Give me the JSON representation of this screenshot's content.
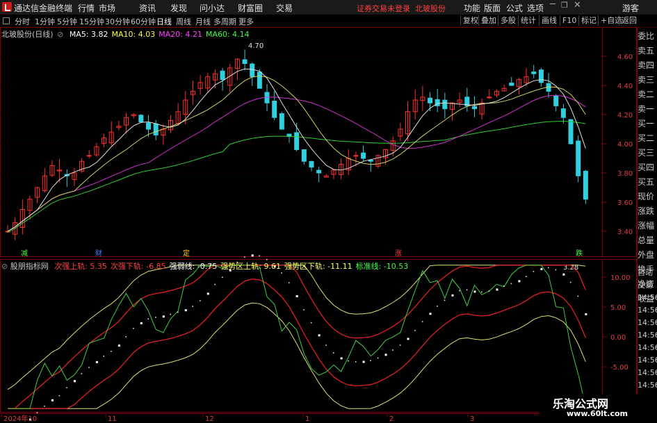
{
  "app": {
    "title": "通达信金融终端",
    "menu": [
      "行情",
      "市场",
      "资讯",
      "发现",
      "问小达",
      "财富圈",
      "交易"
    ],
    "warning": "证券交易未登录",
    "stock_name": "北玻股份",
    "right_menu": [
      "功能",
      "版面",
      "公式",
      "选项"
    ],
    "user": "游客"
  },
  "toolbar": {
    "periods": [
      "分时",
      "1分钟",
      "5分钟",
      "15分钟",
      "30分钟",
      "60分钟",
      "日线",
      "周线",
      "月线",
      "多周期",
      "更多"
    ],
    "active_period": "日线",
    "right": [
      "复权",
      "叠加",
      "多股",
      "统计",
      "画线",
      "F10",
      "标记",
      "+自选",
      "返回"
    ]
  },
  "main_chart": {
    "title": "北玻股份(日线)",
    "ma_labels": [
      {
        "text": "MA5: 3.82",
        "color": "#ffffff"
      },
      {
        "text": "MA10: 4.03",
        "color": "#ffff40"
      },
      {
        "text": "MA20: 4.21",
        "color": "#ff40ff"
      },
      {
        "text": "MA60: 4.14",
        "color": "#40ff40"
      }
    ],
    "y_ticks": [
      "4.60",
      "4.40",
      "4.20",
      "4.00",
      "3.80",
      "3.60",
      "3.40"
    ],
    "high_label": "4.70",
    "low_label": "3.28",
    "markers": [
      {
        "text": "减",
        "color": "#40ff40"
      },
      {
        "text": "财",
        "color": "#4080ff"
      },
      {
        "text": "定",
        "color": "#ffd000"
      },
      {
        "text": "涨",
        "color": "#ff4040"
      },
      {
        "text": "跌",
        "color": "#40ff40"
      }
    ]
  },
  "indicator": {
    "name": "股朋指标网",
    "labels": [
      {
        "text": "次强上轨: 5.35",
        "color": "#ff4040"
      },
      {
        "text": "次强下轨: -6.85",
        "color": "#ff4040"
      },
      {
        "text": "强弱线: -0.75",
        "color": "#ffffff"
      },
      {
        "text": "强势区上轨: 9.61",
        "color": "#ffff60"
      },
      {
        "text": "强势区下轨: -11.11",
        "color": "#ffff60"
      },
      {
        "text": "标准线: -10.53",
        "color": "#40ff40"
      }
    ],
    "y_ticks": [
      "10.00",
      "5.00",
      "0.00",
      "-5.00",
      "-10.00"
    ]
  },
  "x_axis": [
    "2024年10",
    "11",
    "12",
    "1",
    "2",
    "3"
  ],
  "right_panel": {
    "items": [
      "委比",
      "卖五",
      "卖四",
      "卖三",
      "卖二",
      "卖一",
      "买一",
      "买二",
      "买三",
      "买四",
      "买五",
      "现价",
      "涨跌",
      "涨幅",
      "总量",
      "外盘",
      "换手",
      "净资",
      "收益"
    ],
    "lower_items": [
      "自动",
      "交易",
      "14:56",
      "14:56",
      "14:56",
      "14:56",
      "14:56",
      "14:56",
      "14:56",
      "14:56"
    ]
  },
  "watermark": {
    "line1": "乐淘公式网",
    "line2": "www.60lt.com"
  }
}
